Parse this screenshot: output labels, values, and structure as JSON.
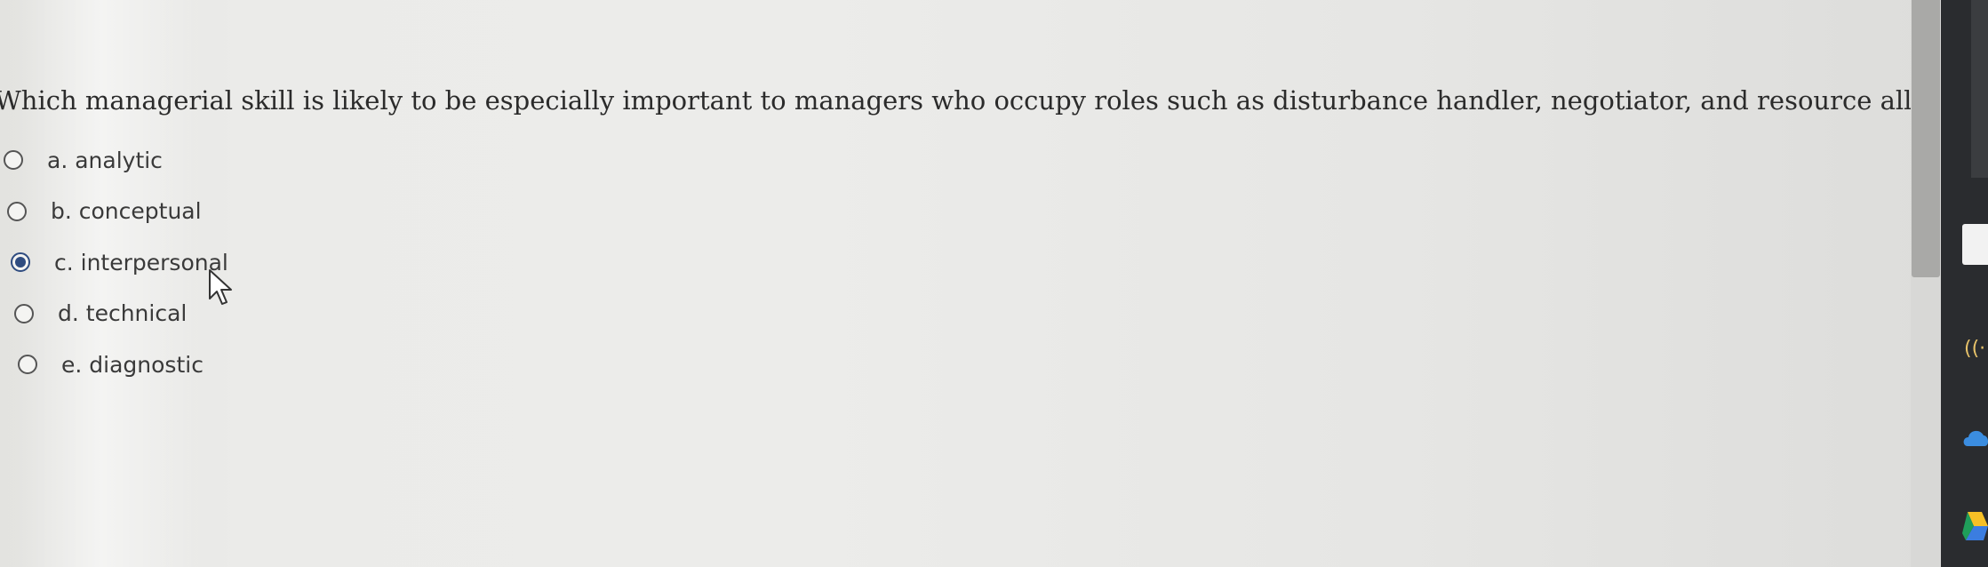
{
  "question": {
    "text": "Which managerial skill is likely to be especially important to managers who occupy roles such as disturbance handler, negotiator, and resource allocator?"
  },
  "options": [
    {
      "label": "a. analytic",
      "selected": false
    },
    {
      "label": "b. conceptual",
      "selected": false
    },
    {
      "label": "c. interpersonal",
      "selected": true
    },
    {
      "label": "d. technical",
      "selected": false
    },
    {
      "label": "e. diagnostic",
      "selected": false
    }
  ],
  "colors": {
    "radio_selected": "#2f4c80",
    "text": "#2b2b2b",
    "background": "#ebebe9"
  },
  "icons": {
    "cursor": "mouse-pointer-icon",
    "wifi": "wifi-icon",
    "cloud": "onedrive-cloud-icon",
    "drive": "google-drive-icon",
    "doc": "document-icon"
  }
}
